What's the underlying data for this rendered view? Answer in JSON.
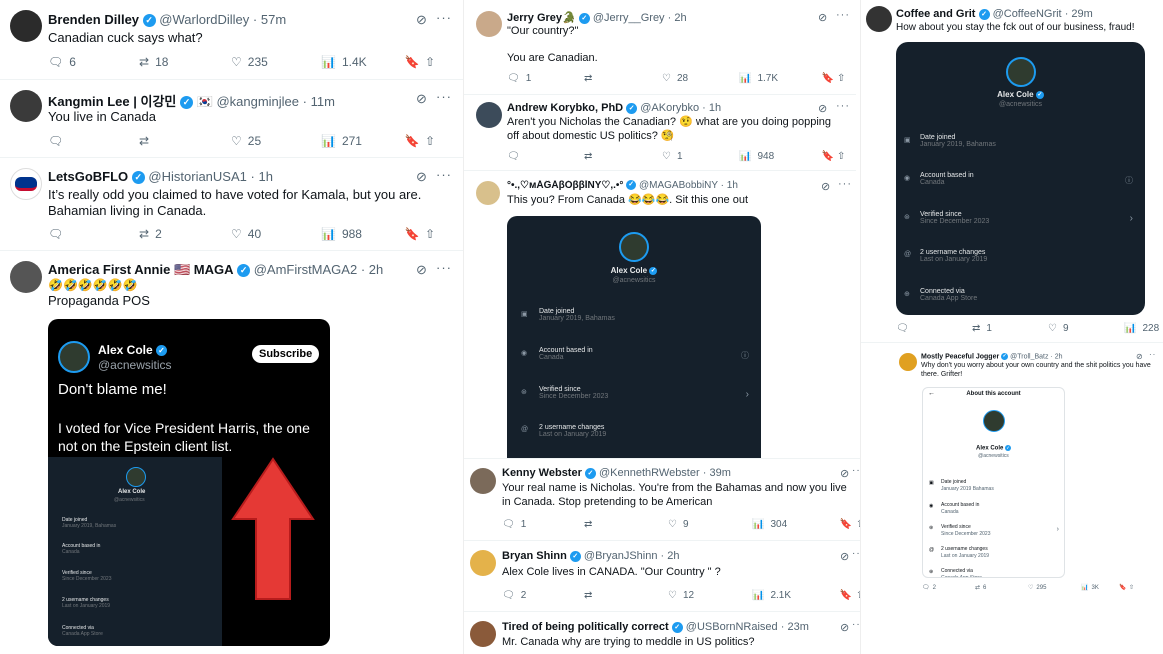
{
  "col1": [
    {
      "name": "Brenden Dilley",
      "handle": "@WarlordDilley",
      "time": "57m",
      "text": "Canadian cuck says what?",
      "replies": "6",
      "reposts": "18",
      "likes": "235",
      "views": "1.4K"
    },
    {
      "name": "Kangmin Lee | 이강민",
      "flag": "🇰🇷",
      "handle": "@kangminjlee",
      "time": "11m",
      "text": "You live in Canada",
      "replies": "",
      "reposts": "",
      "likes": "25",
      "views": "271"
    },
    {
      "name": "LetsGoBFLO",
      "handle": "@HistorianUSA1",
      "time": "1h",
      "text": "It’s really odd you claimed to have voted for Kamala, but you are. Bahamian living in Canada.",
      "replies": "",
      "reposts": "2",
      "likes": "40",
      "views": "988"
    },
    {
      "name": "America First Annie 🇺🇸 MAGA",
      "handle": "@AmFirstMAGA2",
      "time": "2h",
      "text": "🤣🤣🤣🤣🤣🤣",
      "text2": "Propaganda POS"
    }
  ],
  "video": {
    "name": "Alex Cole",
    "handle": "@acnewsitics",
    "subscribe": "Subscribe",
    "line1": "Don't blame me!",
    "line2": "I voted for Vice President Harris, the one not on the Epstein client list."
  },
  "col2": [
    {
      "name": "Jerry Grey🐊",
      "handle": "@Jerry__Grey",
      "time": "2h",
      "text": "\"Our country?\"",
      "text2": "You are Canadian.",
      "replies": "1",
      "reposts": "",
      "likes": "28",
      "views": "1.7K"
    },
    {
      "name": "Andrew Korybko, PhD",
      "handle": "@AKorybko",
      "time": "1h",
      "text": "Aren't you Nicholas the Canadian? 🤨 what are you doing popping off about domestic US politics? 🧐",
      "replies": "",
      "reposts": "",
      "likes": "1",
      "views": "948"
    },
    {
      "name": "°•.,♡ᴍĂĜĂβŎββĬΝΥ♡,.•°",
      "handle": "@MAGABobbiNY",
      "time": "1h",
      "text": "This you? From Canada 😂😂😂. Sit this one out"
    },
    {
      "name": "Kenny Webster",
      "handle": "@KennethRWebster",
      "time": "39m",
      "text": "Your real name is Nicholas.  You're from the Bahamas and now you live in Canada.  Stop pretending to be American",
      "replies": "1",
      "reposts": "",
      "likes": "9",
      "views": "304"
    },
    {
      "name": "Bryan Shinn",
      "handle": "@BryanJShinn",
      "time": "2h",
      "text": "Alex Cole lives in CANADA.  \"Our Country \" ?",
      "replies": "2",
      "reposts": "",
      "likes": "12",
      "views": "2.1K"
    },
    {
      "name": "Tired of being politically correct",
      "handle": "@USBornNRaised",
      "time": "23m",
      "text": "Mr. Canada why are trying to meddle in US politics?"
    }
  ],
  "col3": [
    {
      "name": "Coffee and Grit",
      "handle": "@CoffeeNGrit",
      "time": "29m",
      "text": "How about you stay the fck out of our business, fraud!",
      "replies": "",
      "reposts": "1",
      "likes": "9",
      "views": "228"
    },
    {
      "name": "Mostly Peaceful Jogger",
      "handle": "@Troll_Batz",
      "time": "2h",
      "text": "Why don't you worry about your own country and the shit politics you have there. Grifter!",
      "replies": "2",
      "reposts": "6",
      "likes": "295",
      "views": "3K"
    }
  ],
  "about": {
    "title": "About this account",
    "name": "Alex Cole",
    "handle": "@acnewsitics",
    "rows": [
      {
        "t": "Date joined",
        "s": "January 2019, Bahamas",
        "s2": "January 2019 Bahamas"
      },
      {
        "t": "Account based in",
        "s": "Canada"
      },
      {
        "t": "Verified since",
        "s": "Since December 2023"
      },
      {
        "t": "2 username changes",
        "s": "Last on January 2019"
      },
      {
        "t": "Connected via",
        "s": "Canada App Store"
      }
    ]
  }
}
